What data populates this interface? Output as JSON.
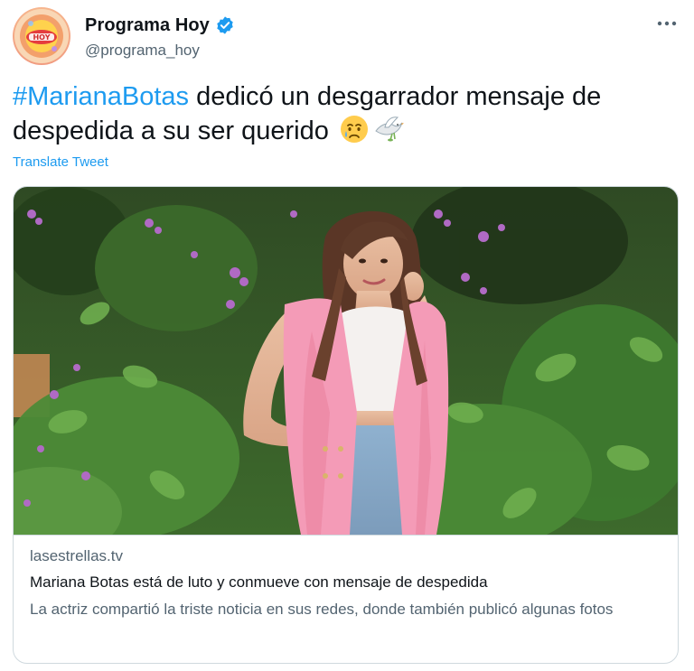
{
  "author": {
    "display_name": "Programa Hoy",
    "handle": "@programa_hoy",
    "verified": true,
    "avatar_icon": "hoy-logo",
    "more_icon": "more-horizontal-icon"
  },
  "tweet": {
    "hashtag": "#MarianaBotas",
    "text": " dedicó un desgarrador mensaje de despedida a su ser querido ",
    "emojis": [
      "crying-face-emoji",
      "dove-emoji"
    ],
    "translate_label": "Translate Tweet"
  },
  "card": {
    "domain": "lasestrellas.tv",
    "title": "Mariana Botas está de luto y conmueve con mensaje de despedida",
    "description": "La actriz compartió la triste noticia en sus redes, donde también publicó algunas fotos"
  },
  "colors": {
    "accent": "#1d9bf0",
    "text_primary": "#0f1419",
    "text_secondary": "#536471",
    "border": "#cfd9de",
    "vest_pink": "#f49bb7",
    "foliage": "#3f6b2e"
  }
}
